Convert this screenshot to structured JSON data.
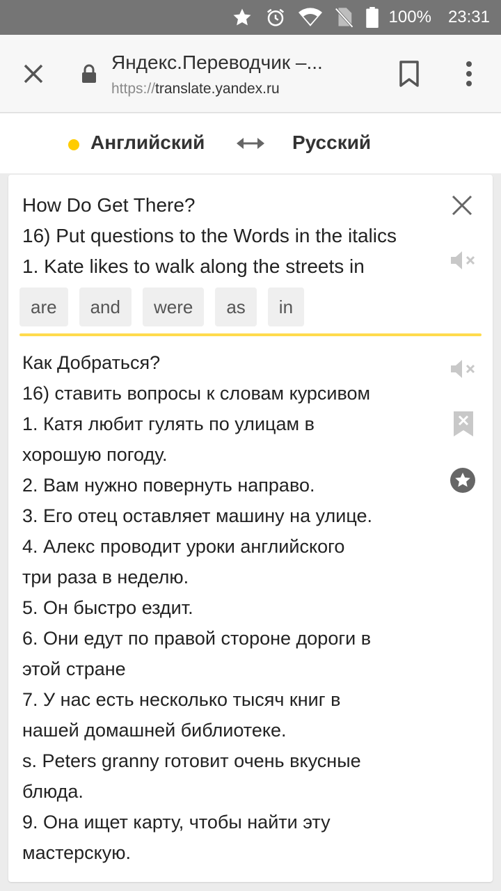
{
  "status_bar": {
    "icons": [
      "star-icon",
      "alarm-icon",
      "wifi-icon",
      "no-sim-icon",
      "battery-icon"
    ],
    "battery": "100%",
    "time": "23:31"
  },
  "browser": {
    "page_title": "Яндекс.Переводчик –...",
    "url_scheme": "https://",
    "url_host": "translate.yandex.ru",
    "icons": [
      "close-icon",
      "lock-icon",
      "bookmark-icon",
      "more-vert-icon"
    ]
  },
  "languages": {
    "source": "Английский",
    "target": "Русский",
    "swap_icon": "swap-arrows-icon",
    "accent": "#ffcc00"
  },
  "source": {
    "lines": [
      "How Do Get There?",
      "16) Put questions to the Words in the italics",
      "1. Kate likes to walk along the streets in"
    ]
  },
  "suggestions": [
    "are",
    "and",
    "were",
    "as",
    "in"
  ],
  "translation": {
    "lines": [
      "Как Добраться?",
      "16) ставить вопросы к словам курсивом",
      "1. Катя любит гулять по улицам в",
      "хорошую погоду.",
      "2. Вам нужно повернуть направо.",
      "3. Его отец оставляет машину на улице.",
      "4. Алекс проводит уроки английского",
      "три раза в неделю.",
      "5. Он быстро ездит.",
      "6. Они едут по правой стороне дороги в",
      "этой стране",
      "7. У нас есть несколько тысяч книг в",
      "нашей домашней библиотеке.",
      "s. Peters granny готовит очень вкусные",
      "блюда.",
      "9. Она ищет карту, чтобы найти эту",
      "мастерскую."
    ]
  }
}
